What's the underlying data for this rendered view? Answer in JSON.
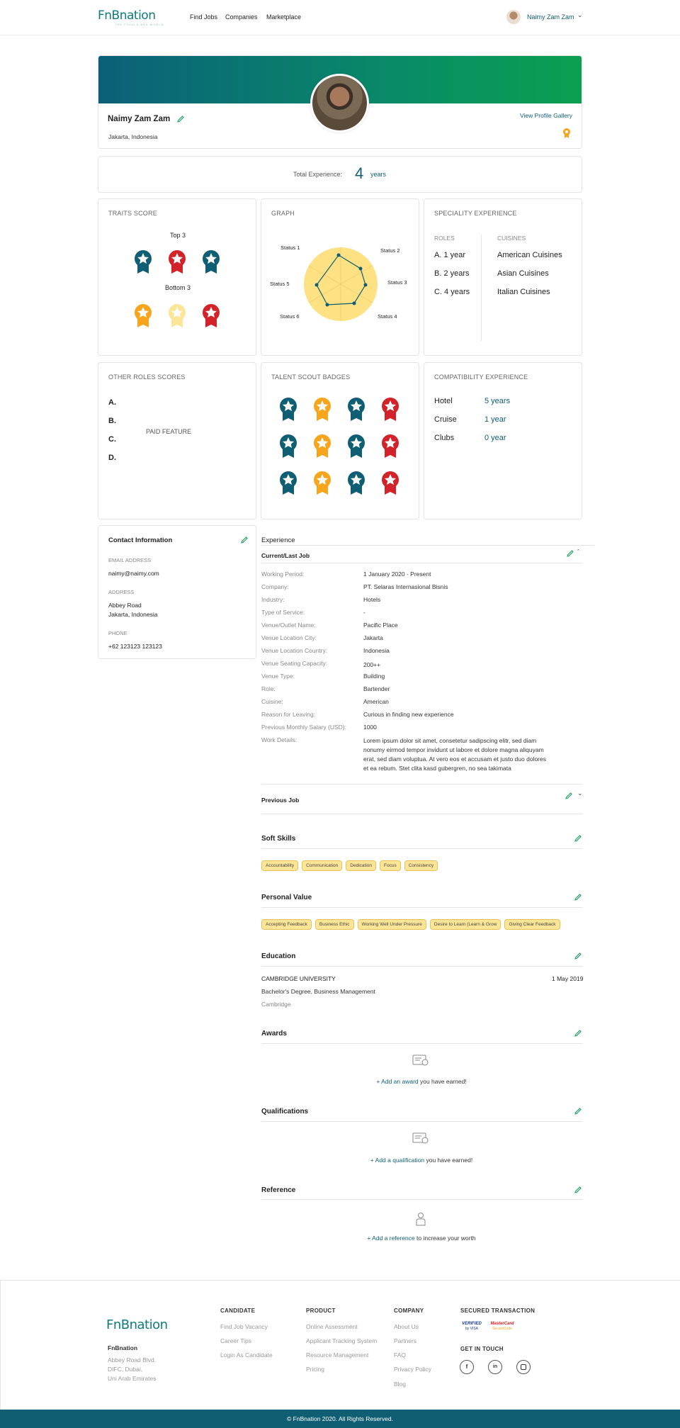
{
  "nav": {
    "logo": "FnBnation",
    "logo_tagline": "THE FOOD & BEV WORLD",
    "links": [
      "Find Jobs",
      "Companies",
      "Marketplace"
    ],
    "user_name": "Naimy Zam Zam"
  },
  "profile": {
    "name": "Naimy Zam Zam",
    "location": "Jakarta, Indonesia",
    "gallery_link": "View Profile Gallery",
    "total_exp_label": "Total Experience:",
    "total_exp_value": "4",
    "total_exp_unit": "years"
  },
  "traits": {
    "title": "TRAITS SCORE",
    "top_label": "Top 3",
    "bottom_label": "Bottom 3"
  },
  "graph": {
    "title": "GRAPH",
    "labels": [
      "Status 1",
      "Status 2",
      "Status 3",
      "Status 4",
      "Status 6",
      "Status 5"
    ]
  },
  "speciality": {
    "title": "SPECIALITY EXPERIENCE",
    "roles_label": "ROLES",
    "cuisines_label": "CUISINES",
    "roles": [
      "A. 1 year",
      "B. 2 years",
      "C. 4 years"
    ],
    "cuisines": [
      "American Cuisines",
      "Asian Cuisines",
      "Italian Cuisines"
    ]
  },
  "other_roles": {
    "title": "OTHER ROLES SCORES",
    "items": [
      "A.",
      "B.",
      "C.",
      "D."
    ],
    "paid": "PAID FEATURE"
  },
  "badges": {
    "title": "TALENT SCOUT BADGES"
  },
  "compat": {
    "title": "COMPATIBILITY EXPERIENCE",
    "items": [
      {
        "label": "Hotel",
        "value": "5 years"
      },
      {
        "label": "Cruise",
        "value": "1 year"
      },
      {
        "label": "Clubs",
        "value": "0 year"
      }
    ]
  },
  "contact": {
    "title": "Contact Information",
    "email_label": "EMAIL ADDRESS",
    "email": "naimy@naimy.com",
    "address_label": "ADDRESS",
    "address1": "Abbey Road",
    "address2": "Jakarta, Indonesia",
    "phone_label": "PHONE",
    "phone": "+62 123123 123123"
  },
  "experience": {
    "title": "Experience",
    "current_title": "Current/Last Job",
    "rows": [
      {
        "label": "Working Period:",
        "value": "1 January 2020 - Present"
      },
      {
        "label": "Company:",
        "value": "PT. Selaras Internasional Bisnis"
      },
      {
        "label": "Industry:",
        "value": "Hotels"
      },
      {
        "label": "Type of Service:",
        "value": "-"
      },
      {
        "label": "Venue/Outlet Name:",
        "value": "Pacific Place"
      },
      {
        "label": "Venue Location City:",
        "value": "Jakarta"
      },
      {
        "label": "Venue Location Country:",
        "value": "Indonesia"
      },
      {
        "label": "Venue Seating Capacity:",
        "value": "200++"
      },
      {
        "label": "Venue Type:",
        "value": "Building"
      },
      {
        "label": "Role:",
        "value": "Bartender"
      },
      {
        "label": "Cuisine:",
        "value": "American"
      },
      {
        "label": "Reason for Leaving:",
        "value": "Curious in finding new experience"
      },
      {
        "label": "Previous Monthly Salary (USD):",
        "value": "1000"
      },
      {
        "label": "Work Details:",
        "value": "Lorem ipsum dolor sit amet, consetetur sadipscing elitr, sed diam nonumy eirmod tempor invidunt ut labore et dolore magna aliquyam erat, sed diam voluptua. At vero eos et accusam et justo duo dolores et ea rebum. Stet clita kasd gubergren, no sea takimata"
      }
    ],
    "previous_title": "Previous Job"
  },
  "soft_skills": {
    "title": "Soft Skills",
    "items": [
      "Accountability",
      "Communication",
      "Dedication",
      "Focus",
      "Consistency"
    ]
  },
  "personal_value": {
    "title": "Personal Value",
    "items": [
      "Accepting Feedback",
      "Business Ethic",
      "Working Well Under Pressure",
      "Desire to Learn (Learn & Grow",
      "Giving Clear Feedback"
    ]
  },
  "education": {
    "title": "Education",
    "school": "CAMBRIDGE UNIVERSITY",
    "date": "1 May 2019",
    "degree": "Bachelor's Degree, Business Management",
    "city": "Cambridge"
  },
  "awards": {
    "title": "Awards",
    "link": "+ Add an award",
    "rest": " you have earned!"
  },
  "qualifications": {
    "title": "Qualifications",
    "link": "+ Add a qualification",
    "rest": " you have earned!"
  },
  "reference": {
    "title": "Reference",
    "link": "+ Add a reference",
    "rest": " to increase your worth"
  },
  "footer": {
    "logo": "FnBnation",
    "company_name": "FnBnation",
    "address": [
      "Abbey Road Blvd.",
      "DIFC, Dubai,",
      "Uni Arab Emirates"
    ],
    "candidate_title": "CANDIDATE",
    "candidate_links": [
      "Find Job Vacancy",
      "Career Tips",
      "Login As Candidate"
    ],
    "product_title": "PRODUCT",
    "product_links": [
      "Online Assessment",
      "Applicant Tracking System",
      "Resource Management",
      "Pricing"
    ],
    "company_title": "COMPANY",
    "company_links": [
      "About Us",
      "Partners",
      "FAQ",
      "Privacy Policy",
      "Blog"
    ],
    "secured_title": "SECURED TRANSACTION",
    "verified": "VERIFIED",
    "by_visa": "by VISA",
    "mastercard": "MasterCard",
    "securecode": "SecureCode",
    "touch_title": "GET IN TOUCH",
    "copyright": "© FnBnation 2020. All Rights Reserved."
  },
  "colors": {
    "teal": "#0f5e73",
    "green": "#0aa04f",
    "gold": "#f7a51c",
    "red": "#d2232a",
    "yellow": "#fde598"
  }
}
